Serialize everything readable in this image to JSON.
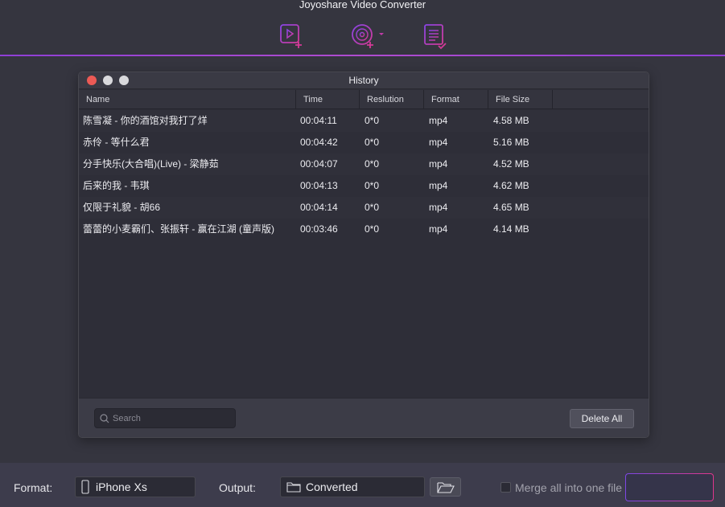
{
  "app": {
    "title": "Joyoshare Video Converter"
  },
  "history": {
    "title": "History",
    "columns": [
      "Name",
      "Time",
      "Reslution",
      "Format",
      "File Size"
    ],
    "rows": [
      {
        "name": "陈雪凝 - 你的酒馆对我打了烊",
        "time": "00:04:11",
        "resolution": "0*0",
        "format": "mp4",
        "size": "4.58 MB"
      },
      {
        "name": "赤伶 - 等什么君",
        "time": "00:04:42",
        "resolution": "0*0",
        "format": "mp4",
        "size": "5.16 MB"
      },
      {
        "name": "分手快乐(大合唱)(Live) - 梁静茹",
        "time": "00:04:07",
        "resolution": "0*0",
        "format": "mp4",
        "size": "4.52 MB"
      },
      {
        "name": "后来的我 - 韦琪",
        "time": "00:04:13",
        "resolution": "0*0",
        "format": "mp4",
        "size": "4.62 MB"
      },
      {
        "name": "仅限于礼貌 - 胡66",
        "time": "00:04:14",
        "resolution": "0*0",
        "format": "mp4",
        "size": "4.65 MB"
      },
      {
        "name": "蕾蕾的小麦霸们、张振轩 - 赢在江湖 (童声版)",
        "time": "00:03:46",
        "resolution": "0*0",
        "format": "mp4",
        "size": "4.14 MB"
      }
    ],
    "search_placeholder": "Search",
    "delete_all_label": "Delete All"
  },
  "bottom": {
    "format_label": "Format:",
    "format_value": "iPhone Xs",
    "output_label": "Output:",
    "output_value": "Converted",
    "merge_label": "Merge all into one file"
  },
  "icons": {
    "add_video": "add-video-icon",
    "add_dvd": "add-dvd-icon",
    "history": "history-list-icon",
    "phone": "phone-icon",
    "folder": "folder-icon",
    "open_folder": "open-folder-icon",
    "search": "search-icon"
  },
  "colors": {
    "accent_purple": "#8f3fd6",
    "accent_pink": "#e0368b",
    "close_red": "#ec5a55"
  }
}
